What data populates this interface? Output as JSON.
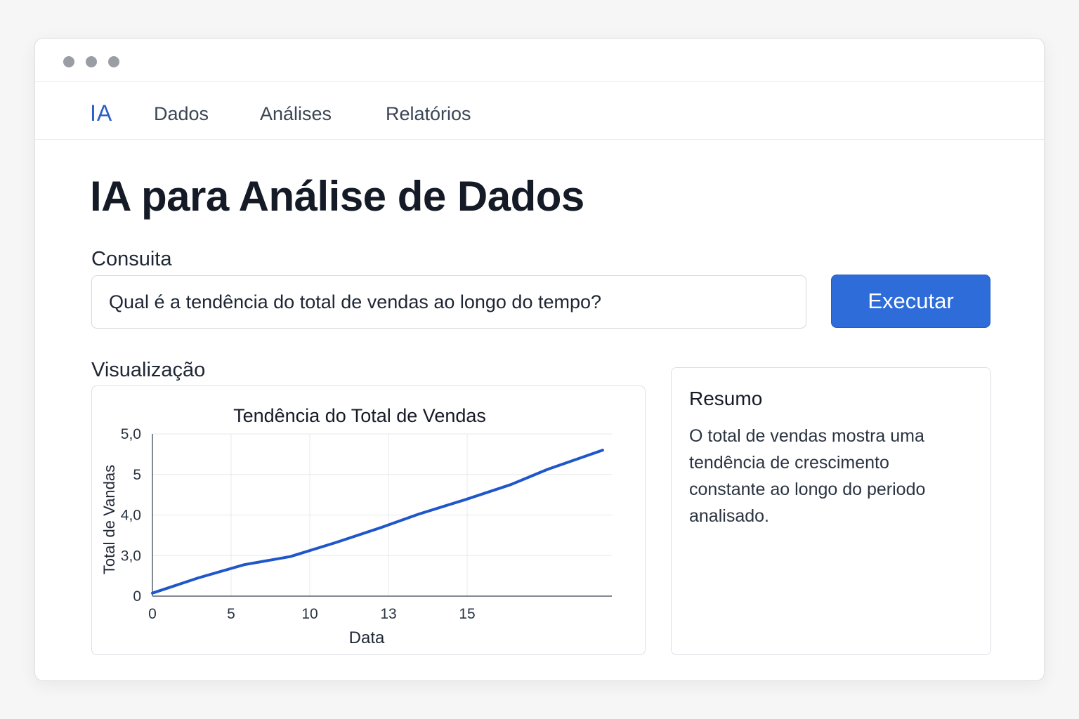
{
  "nav": {
    "logo": "IA",
    "items": [
      {
        "label": "Dados"
      },
      {
        "label": "Análises"
      },
      {
        "label": "Relatórios"
      }
    ]
  },
  "page": {
    "title": "IA para Análise de Dados"
  },
  "query": {
    "label": "Consuita",
    "value": "Qual é a tendência do total de vendas ao longo do tempo?",
    "run_label": "Executar"
  },
  "visualization": {
    "label": "Visualização"
  },
  "summary": {
    "title": "Resumo",
    "text": "O total de vendas mostra uma tendência de crescimento constante ao longo do periodo analisado."
  },
  "colors": {
    "accent": "#2d6cd9",
    "line": "#1f56c9",
    "logo": "#2b5fc7"
  },
  "chart_data": {
    "type": "line",
    "title": "Tendência do Total de Vendas",
    "xlabel": "Data",
    "ylabel": "Total de Vandas",
    "x_ticks": [
      "0",
      "5",
      "10",
      "13",
      "15"
    ],
    "y_ticks": [
      "0",
      "3,0",
      "4,0",
      "5",
      "5,0"
    ],
    "grid": true,
    "series": [
      {
        "x": [
          0,
          1,
          2,
          3,
          4,
          5,
          5.8,
          6.8,
          7.8,
          8.6,
          9.8
        ],
        "y": [
          0.15,
          0.9,
          1.55,
          1.95,
          2.65,
          3.4,
          4.05,
          4.75,
          5.5,
          6.25,
          7.2
        ]
      }
    ],
    "xlim": [
      0,
      10
    ],
    "ylim": [
      0,
      8
    ]
  }
}
